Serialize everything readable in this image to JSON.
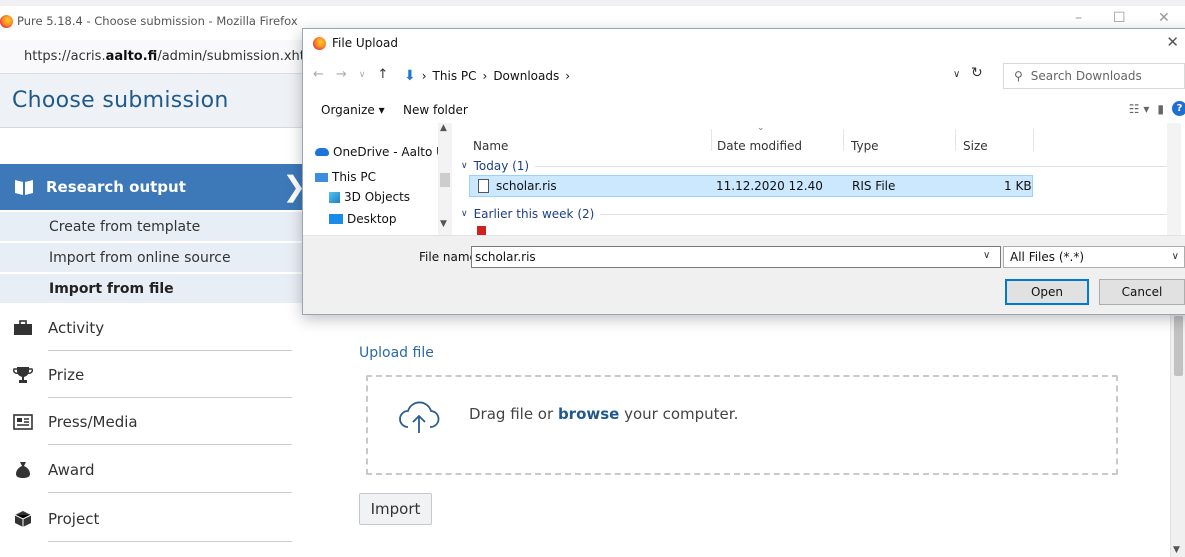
{
  "window": {
    "title": "Pure 5.18.4 - Choose submission - Mozilla Firefox",
    "url_prefix": "https://acris.",
    "url_host": "aalto.fi",
    "url_path": "/admin/submission.xhtml",
    "minimize": "–",
    "maximize": "☐",
    "close": "✕"
  },
  "page": {
    "title": "Choose submission",
    "nav_active": "Research output",
    "subnav": [
      "Create from template",
      "Import from online source",
      "Import from file"
    ],
    "nav_items": [
      {
        "label": "Activity",
        "icon": "briefcase-icon"
      },
      {
        "label": "Prize",
        "icon": "trophy-icon"
      },
      {
        "label": "Press/Media",
        "icon": "newspaper-icon"
      },
      {
        "label": "Award",
        "icon": "money-bag-icon"
      },
      {
        "label": "Project",
        "icon": "cube-icon"
      }
    ],
    "upload_title": "Upload file",
    "drop_prefix": "Drag file or ",
    "drop_link": "browse",
    "drop_suffix": " your computer.",
    "import_label": "Import"
  },
  "dialog": {
    "title": "File Upload",
    "close": "✕",
    "path": [
      "This PC",
      "Downloads"
    ],
    "path_sep": "›",
    "search_placeholder": "Search Downloads",
    "toolbar": {
      "organize": "Organize ▾",
      "new_folder": "New folder"
    },
    "tree": [
      "OneDrive - Aalto U",
      "This PC",
      "3D Objects",
      "Desktop"
    ],
    "columns": {
      "name": "Name",
      "date": "Date modified",
      "type": "Type",
      "size": "Size"
    },
    "group_today": "Today (1)",
    "group_earlier": "Earlier this week (2)",
    "file": {
      "name": "scholar.ris",
      "date": "11.12.2020 12.40",
      "type": "RIS File",
      "size": "1 KB"
    },
    "filename_label": "File name:",
    "filename_value": "scholar.ris",
    "filter": "All Files (*.*)",
    "open": "Open",
    "cancel": "Cancel"
  },
  "colors": {
    "accent": "#3d78b8",
    "title_blue": "#1f5a8a",
    "selection": "#cce8ff"
  }
}
